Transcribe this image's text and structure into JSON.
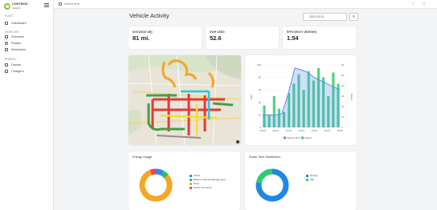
{
  "app": {
    "logo_title": "LIGHTNING",
    "logo_subtitle": "Insights"
  },
  "search": {
    "placeholder": "Search here"
  },
  "sidebar": {
    "sections": [
      {
        "label": "FLEET",
        "items": [
          {
            "label": "Dashboard",
            "icon": "dashboard-icon"
          }
        ]
      },
      {
        "label": "VEHICLES",
        "items": [
          {
            "label": "Overview",
            "icon": "car-icon"
          },
          {
            "label": "Routes",
            "icon": "route-icon"
          },
          {
            "label": "Schedules",
            "icon": "calendar-icon"
          }
        ]
      },
      {
        "label": "ENERGY",
        "items": [
          {
            "label": "Depots",
            "icon": "depot-icon"
          },
          {
            "label": "Chargers",
            "icon": "charger-icon"
          }
        ]
      }
    ]
  },
  "page": {
    "title": "Vehicle Activity",
    "date": "2022-03-01",
    "filter_icon": "filter-icon"
  },
  "stats": [
    {
      "label": "DISTANCE (MI)",
      "value": "81 mi."
    },
    {
      "label": "KWH USED",
      "value": "52.6"
    },
    {
      "label": "EFFICIENCY (MI/KWH)",
      "value": "1.54"
    }
  ],
  "speed_chart": {
    "left_axis_label": "SOC",
    "right_axis_label": "Speed",
    "x_ticks": [
      "06:00",
      "08:00",
      "10:00",
      "12:00",
      "14:00",
      "16:00",
      "18:00"
    ],
    "y_left_ticks": [
      "100",
      "80",
      "60",
      "40",
      "20",
      "0"
    ],
    "y_right_ticks": [
      "60",
      "50",
      "40",
      "30",
      "20",
      "10",
      "0"
    ],
    "legend": [
      "Vehicle SOC",
      "Speed"
    ],
    "colors": {
      "soc": "#5b8def",
      "speed": "#2ecc71"
    }
  },
  "chart_data": [
    {
      "type": "line",
      "title": "",
      "xlabel": "",
      "ylabel": "SOC",
      "ylim": [
        0,
        100
      ],
      "x": [
        "06:00",
        "07:00",
        "08:00",
        "09:00",
        "10:00",
        "11:00",
        "12:00",
        "13:00",
        "14:00",
        "15:00",
        "16:00",
        "17:00",
        "18:00"
      ],
      "series": [
        {
          "name": "Vehicle SOC",
          "values": [
            20,
            20,
            20,
            22,
            55,
            95,
            92,
            88,
            80,
            75,
            70,
            65,
            60
          ]
        }
      ]
    },
    {
      "type": "bar",
      "title": "Energy Usage",
      "categories": [
        "HVAC",
        "Battery Thermal Management",
        "Drive",
        "DCDC Converter"
      ],
      "values": [
        8,
        6,
        80,
        6
      ],
      "colors": [
        "#3b82f6",
        "#22c55e",
        "#f5a623",
        "#ef4444"
      ]
    },
    {
      "type": "bar",
      "title": "Route Time Distribution",
      "categories": [
        "Driving",
        "Idle"
      ],
      "values": [
        78,
        22
      ],
      "colors": [
        "#1e88e5",
        "#2ecc71"
      ]
    }
  ],
  "map": {
    "description_icon": "map-icon"
  }
}
